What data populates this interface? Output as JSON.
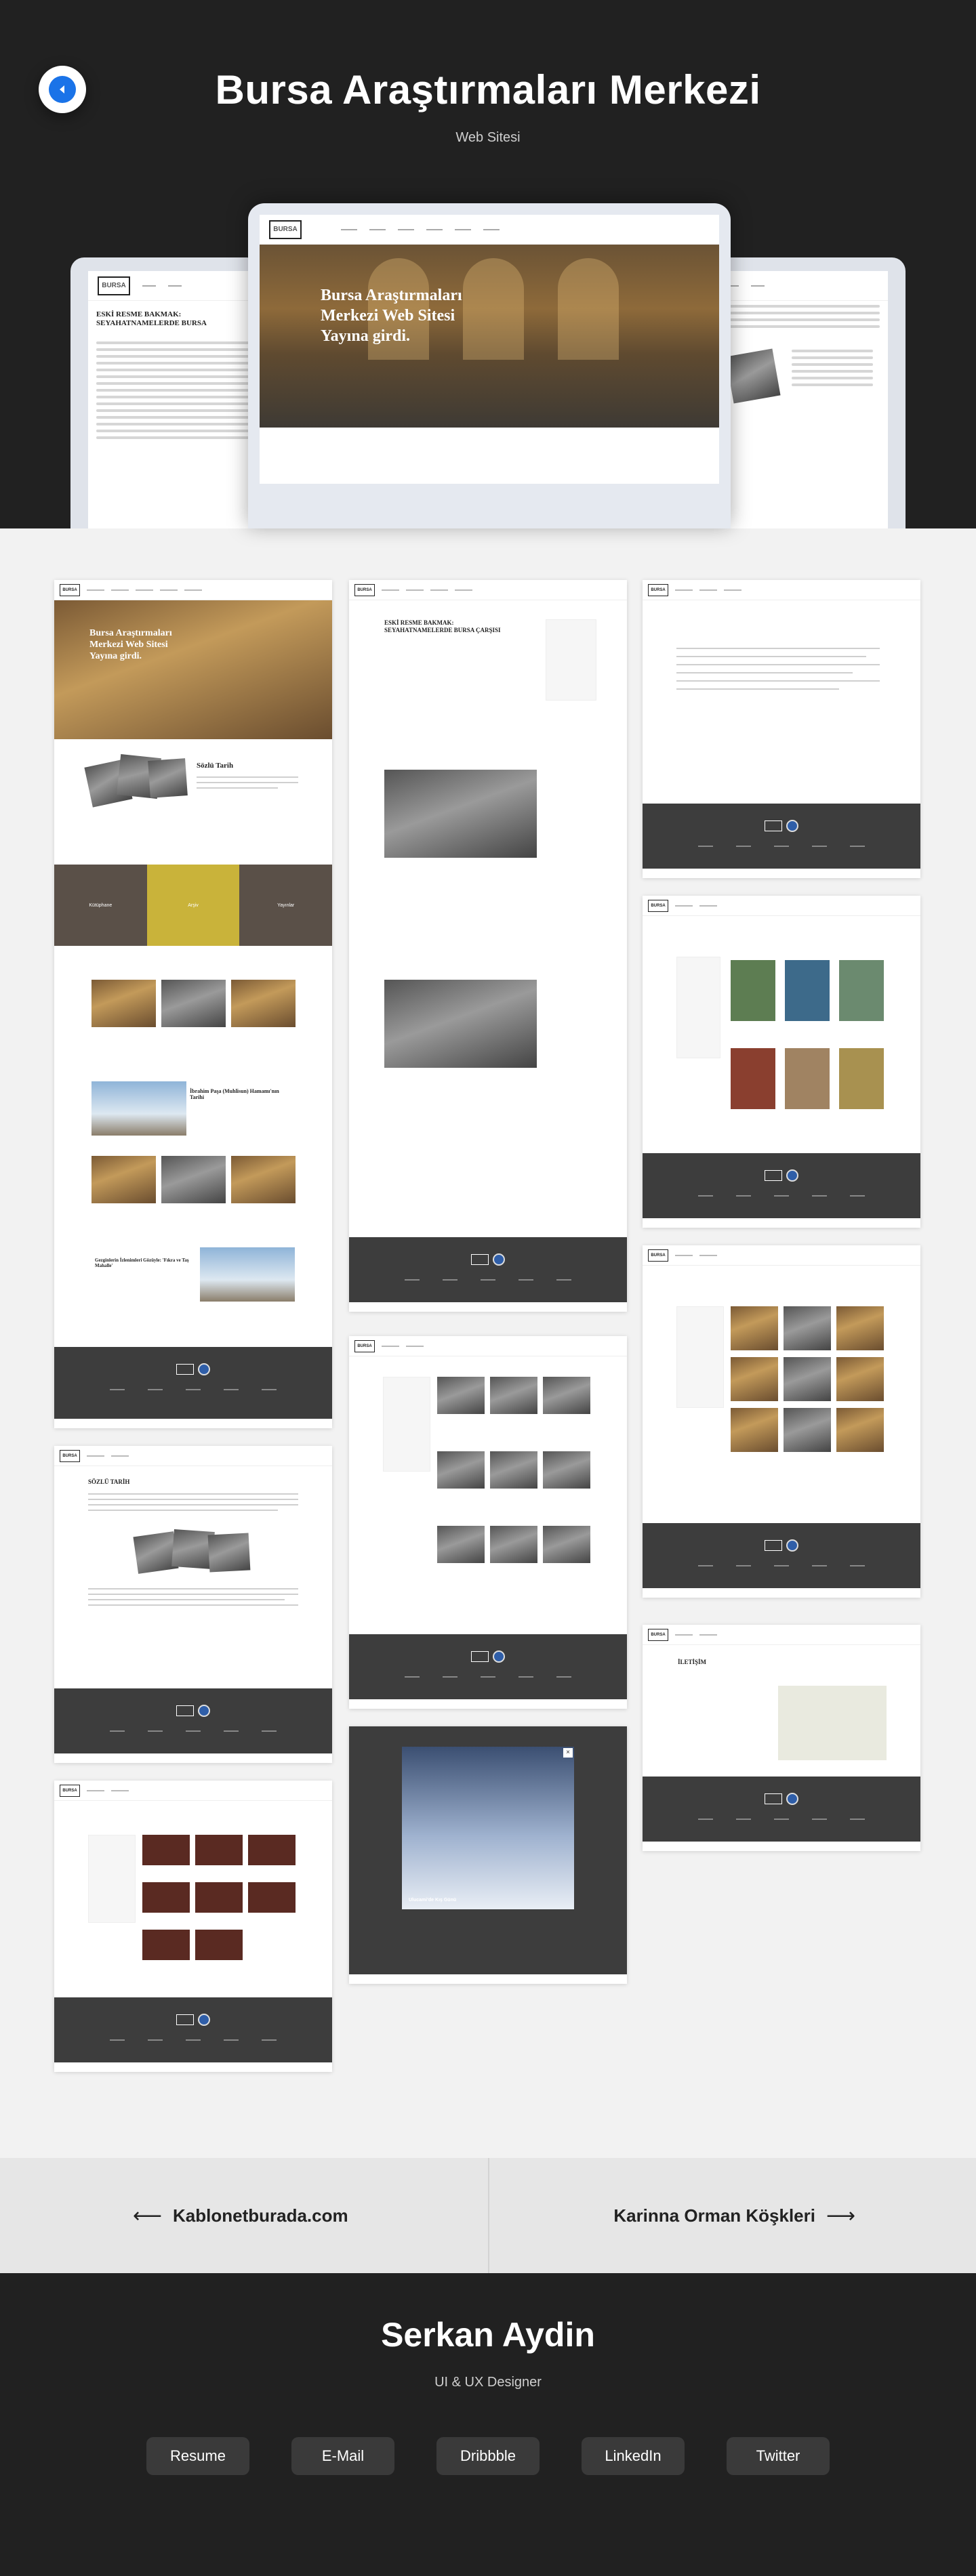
{
  "hero": {
    "title": "Bursa Araştırmaları Merkezi",
    "subtitle": "Web Sitesi",
    "mockup_headline": "Bursa Araştırmaları Merkezi Web Sitesi Yayına girdi.",
    "mockup_logo": "BURSA",
    "left_article_title": "ESKİ RESME BAKMAK: SEYAHATNAMELERDE BURSA"
  },
  "gallery": {
    "home_section_title": "Sözlü Tarih",
    "home_cards": [
      "Kütüphane",
      "Arşiv",
      "Yayınlar"
    ],
    "article_title": "ESKİ RESME BAKMAK: SEYAHATNAMELERDE BURSA ÇARŞISI",
    "oral_history_title": "SÖZLÜ TARİH",
    "contact_title": "İLETİŞİM",
    "winter_caption": "Ulucami'de Kış Günü",
    "featured_1": "İbrahim Paşa (Muhlisun) Hamamı'nın Tarihi",
    "featured_2": "Gezginlerin İzlenimleri Gözüyle: 'Fıkra ve Taş Mahalle'"
  },
  "nav": {
    "prev_label": "Kablonetburada.com",
    "next_label": "Karinna Orman Köşkleri",
    "prev_arrow": "⟵",
    "next_arrow": "⟶"
  },
  "footer": {
    "name": "Serkan Aydin",
    "role": "UI & UX Designer",
    "buttons": [
      "Resume",
      "E-Mail",
      "Dribbble",
      "LinkedIn",
      "Twitter"
    ]
  }
}
